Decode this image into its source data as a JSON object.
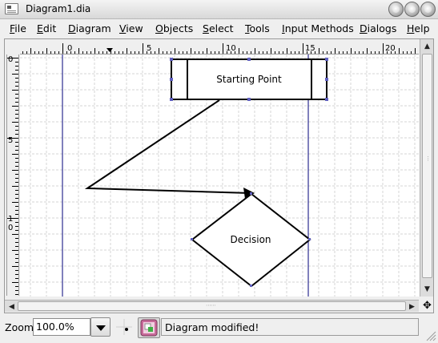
{
  "window": {
    "title": "Diagram1.dia"
  },
  "menubar": {
    "items": [
      {
        "mnemonic": "F",
        "rest": "ile"
      },
      {
        "mnemonic": "E",
        "rest": "dit"
      },
      {
        "mnemonic": "D",
        "rest": "iagram"
      },
      {
        "mnemonic": "V",
        "rest": "iew"
      },
      {
        "mnemonic": "O",
        "rest": "bjects"
      },
      {
        "mnemonic": "S",
        "rest": "elect"
      },
      {
        "mnemonic": "T",
        "rest": "ools"
      },
      {
        "mnemonic": "I",
        "rest": "nput Methods"
      },
      {
        "mnemonic": "D",
        "rest": "ialogs"
      },
      {
        "mnemonic": "H",
        "rest": "elp"
      }
    ]
  },
  "rulers": {
    "horizontal_labels": [
      "0",
      "5",
      "10",
      "15",
      "20"
    ],
    "vertical_labels": [
      "0",
      "5",
      "1\n0"
    ]
  },
  "diagram": {
    "process_box_label": "Starting Point",
    "decision_label": "Decision"
  },
  "statusbar": {
    "zoom_label": "Zoom",
    "zoom_value": "100.0%",
    "status_message": "Diagram modified!"
  },
  "colors": {
    "grid_line": "#d4d4d4",
    "guide_line": "#00007a",
    "selection_handle": "#6060c0"
  }
}
